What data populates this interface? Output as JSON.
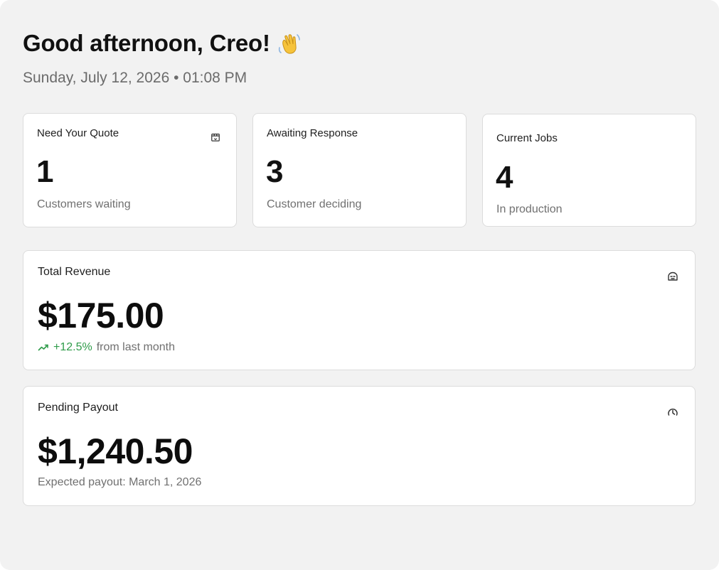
{
  "header": {
    "greeting": "Good afternoon, Creo!",
    "wave_emoji": "👋",
    "datetime": "Sunday, July 12, 2026 • 01:08 PM"
  },
  "stats": [
    {
      "label": "Need Your Quote",
      "value": "1",
      "sub": "Customers waiting",
      "icon": "quote-box-icon"
    },
    {
      "label": "Awaiting Response",
      "value": "3",
      "sub": "Customer deciding"
    },
    {
      "label": "Current Jobs",
      "value": "4",
      "sub": "In production"
    }
  ],
  "revenue": {
    "label": "Total Revenue",
    "amount": "$175.00",
    "trend_pct": "+12.5%",
    "trend_text": "from last month",
    "trend_color": "#2f9c4a",
    "icon": "revenue-icon"
  },
  "payout": {
    "label": "Pending Payout",
    "amount": "$1,240.50",
    "note": "Expected payout: March 1, 2026",
    "icon": "clock-icon"
  },
  "colors": {
    "background": "#f2f2f2",
    "card": "#ffffff",
    "border": "#dcdcdc",
    "muted_text": "#707070"
  }
}
